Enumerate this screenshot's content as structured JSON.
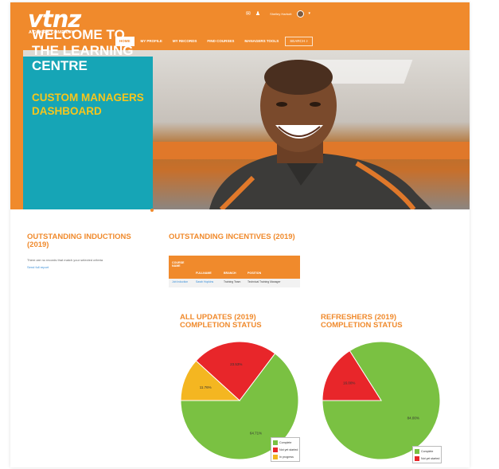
{
  "brand": {
    "logo_text": "vtnz",
    "logo_sub": "A DEKRA COMPANY",
    "color": "#f08a2c"
  },
  "utility": {
    "mail_icon": "envelope-icon",
    "user_icon": "person-icon",
    "user_name": "Shelley Harbott"
  },
  "nav": {
    "items": [
      {
        "label": "HOME",
        "active": true
      },
      {
        "label": "MY PROFILE",
        "active": false
      },
      {
        "label": "MY RECORDS",
        "active": false
      },
      {
        "label": "FIND COURSES",
        "active": false
      },
      {
        "label": "MANAGERS TOOLS",
        "active": false
      }
    ],
    "search_label": "SEARCH"
  },
  "hero": {
    "title": "WELCOME TO THE LEARNING CENTRE",
    "subtitle": "CUSTOM MANAGERS DASHBOARD",
    "box_color": "#16a5b6",
    "subtitle_color": "#f7c61c"
  },
  "inductions": {
    "title": "OUTSTANDING INDUCTIONS (2019)",
    "message": "There are no records that match your selected criteria",
    "link": "Send full report"
  },
  "incentives": {
    "title": "OUTSTANDING INCENTIVES (2019)",
    "columns": [
      "COURSE NAME",
      "FULLNAME",
      "BRANCH",
      "POSITION"
    ],
    "rows": [
      [
        "Job Induction",
        "Sarah Hopkins",
        "Training Team",
        "Technical Training Manager"
      ]
    ]
  },
  "chart_data": [
    {
      "type": "pie",
      "title": "ALL UPDATES (2019) COMPLETION STATUS",
      "slices": [
        {
          "name": "Complete",
          "value": 64.71,
          "label": "64.71%",
          "color": "#7ac142"
        },
        {
          "name": "Not yet started",
          "value": 23.53,
          "label": "23.53%",
          "color": "#e8262a"
        },
        {
          "name": "In progress",
          "value": 11.76,
          "label": "11.76%",
          "color": "#f4b621"
        }
      ],
      "legend_position": "bottom-right"
    },
    {
      "type": "pie",
      "title": "REFRESHERS (2019) COMPLETION STATUS",
      "slices": [
        {
          "name": "Complete",
          "value": 84.0,
          "label": "84.00%",
          "color": "#7ac142"
        },
        {
          "name": "Not yet started",
          "value": 16.0,
          "label": "16.00%",
          "color": "#e8262a"
        }
      ],
      "legend_position": "bottom-right"
    }
  ]
}
